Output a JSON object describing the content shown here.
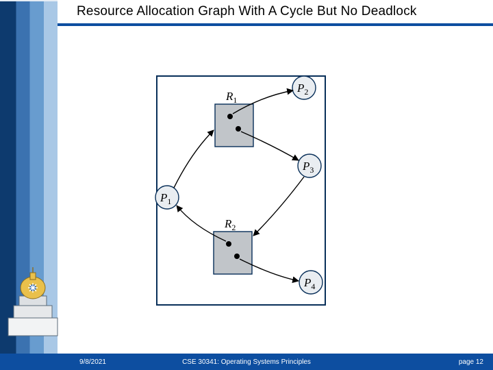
{
  "slide": {
    "title": "Resource Allocation Graph With A Cycle But No Deadlock"
  },
  "footer": {
    "date": "9/8/2021",
    "course": "CSE 30341: Operating Systems Principles",
    "page_label": "page 12"
  },
  "graph": {
    "processes": {
      "P1": "P",
      "P1_sub": "1",
      "P2": "P",
      "P2_sub": "2",
      "P3": "P",
      "P3_sub": "3",
      "P4": "P",
      "P4_sub": "4"
    },
    "resources": {
      "R1": "R",
      "R1_sub": "1",
      "R2": "R",
      "R2_sub": "2"
    }
  },
  "diagram_meta": {
    "type": "resource_allocation_graph",
    "processes": [
      "P1",
      "P2",
      "P3",
      "P4"
    ],
    "resources": [
      {
        "name": "R1",
        "instances": 2
      },
      {
        "name": "R2",
        "instances": 2
      }
    ],
    "request_edges": [
      {
        "from": "P1",
        "to": "R1"
      },
      {
        "from": "P3",
        "to": "R2"
      }
    ],
    "assignment_edges": [
      {
        "from": "R1",
        "to": "P2"
      },
      {
        "from": "R1",
        "to": "P3"
      },
      {
        "from": "R2",
        "to": "P1"
      },
      {
        "from": "R2",
        "to": "P4"
      }
    ],
    "has_cycle": true,
    "has_deadlock": false
  }
}
